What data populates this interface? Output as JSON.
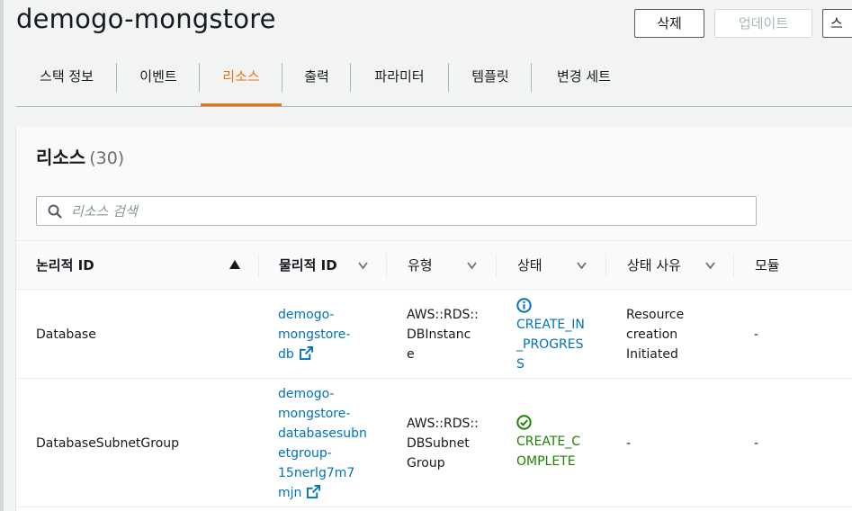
{
  "page": {
    "title": "demogo-mongstore"
  },
  "header_buttons": {
    "delete": "삭제",
    "update": "업데이트",
    "stack_actions": "스"
  },
  "tabs": [
    {
      "label": "스택 정보",
      "active": false
    },
    {
      "label": "이벤트",
      "active": false
    },
    {
      "label": "리소스",
      "active": true
    },
    {
      "label": "출력",
      "active": false
    },
    {
      "label": "파라미터",
      "active": false
    },
    {
      "label": "템플릿",
      "active": false
    },
    {
      "label": "변경 세트",
      "active": false
    }
  ],
  "resources": {
    "title": "리소스",
    "count": "(30)",
    "search_placeholder": "리소스 검색",
    "columns": {
      "logical_id": "논리적 ID",
      "physical_id": "물리적 ID",
      "type": "유형",
      "status": "상태",
      "status_reason": "상태 사유",
      "module": "모듈"
    },
    "rows": [
      {
        "logical_id": "Database",
        "physical_id_lines": [
          "demogo-",
          "mongstore-",
          "db"
        ],
        "type_lines": [
          "AWS::RDS::",
          "DBInstanc",
          "e"
        ],
        "status_lines": [
          "CREATE_IN",
          "_PROGRES",
          "S"
        ],
        "status_kind": "in-progress",
        "reason_lines": [
          "Resource",
          "creation",
          "Initiated"
        ],
        "module": "-"
      },
      {
        "logical_id": "DatabaseSubnetGroup",
        "physical_id_lines": [
          "demogo-",
          "mongstore-",
          "databasesubn",
          "etgroup-",
          "15nerlg7m7",
          "mjn"
        ],
        "type_lines": [
          "AWS::RDS::",
          "DBSubnet",
          "Group"
        ],
        "status_lines": [
          "CREATE_C",
          "OMPLETE"
        ],
        "status_kind": "complete",
        "reason": "-",
        "module": "-"
      }
    ]
  },
  "colors": {
    "accent": "#ec7211",
    "link": "#0073bb",
    "success": "#1d8102"
  }
}
